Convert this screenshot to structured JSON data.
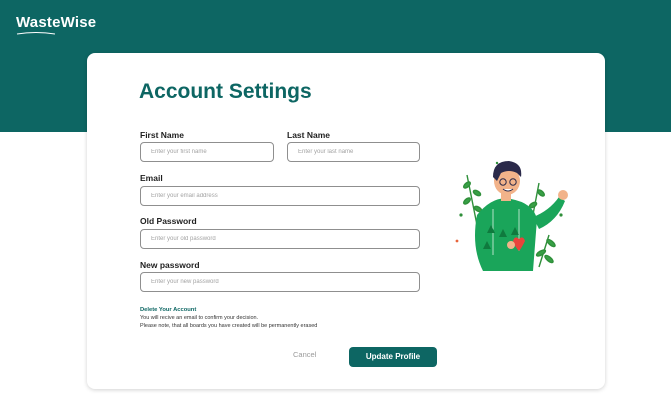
{
  "brand": {
    "logo_text": "WasteWise",
    "primary_color": "#0d6663"
  },
  "page": {
    "title": "Account Settings"
  },
  "form": {
    "first_name": {
      "label": "First Name",
      "placeholder": "Enter your first name"
    },
    "last_name": {
      "label": "Last Name",
      "placeholder": "Enter your last name"
    },
    "email": {
      "label": "Email",
      "placeholder": "Enter your email address"
    },
    "old_password": {
      "label": "Old Password",
      "placeholder": "Enter your old password"
    },
    "new_password": {
      "label": "New password",
      "placeholder": "Enter your new password"
    }
  },
  "delete_account": {
    "title": "Delete Your Account",
    "line1": "You will recive an email to confirm your decision.",
    "line2": "Please note, that all boards you have created will be permanently erased"
  },
  "actions": {
    "cancel_label": "Cancel",
    "update_label": "Update Profile"
  },
  "illustration": {
    "icon": "person-waving-with-plants"
  }
}
